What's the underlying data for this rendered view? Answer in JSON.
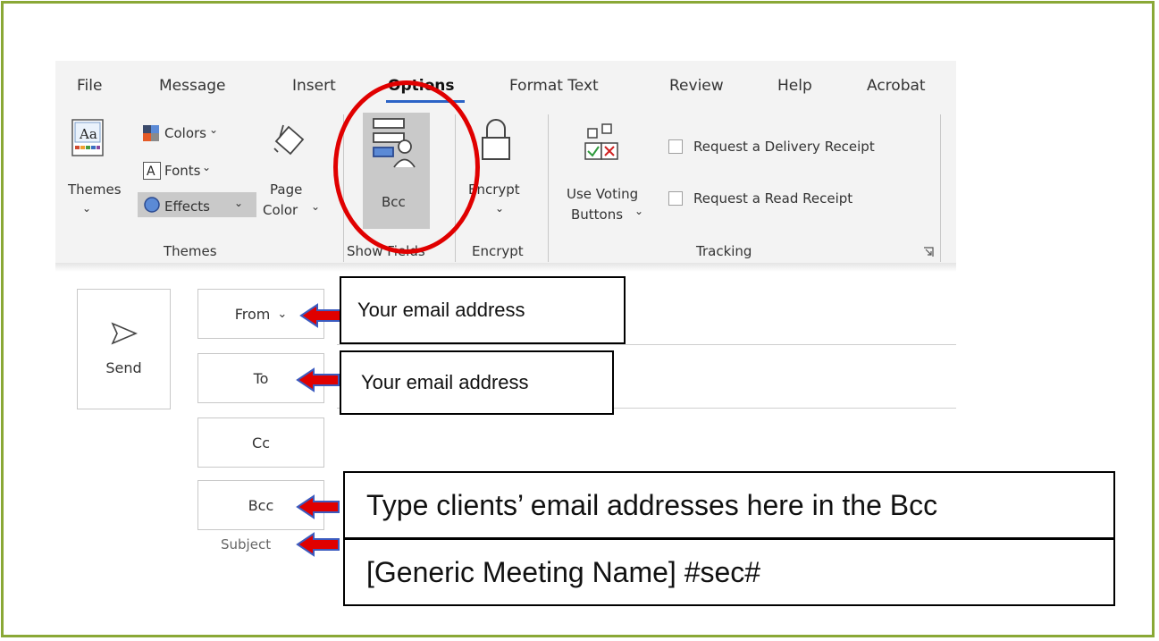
{
  "tabs": [
    "File",
    "Message",
    "Insert",
    "Options",
    "Format Text",
    "Review",
    "Help",
    "Acrobat"
  ],
  "active_tab": "Options",
  "ribbon": {
    "themes_button": "Themes",
    "colors": "Colors",
    "fonts": "Fonts",
    "effects": "Effects",
    "page_color_line1": "Page",
    "page_color_line2": "Color",
    "bcc": "Bcc",
    "encrypt": "Encrypt",
    "voting_line1": "Use Voting",
    "voting_line2": "Buttons",
    "delivery_receipt": "Request a Delivery Receipt",
    "read_receipt": "Request a Read Receipt",
    "groups": {
      "themes": "Themes",
      "show_fields": "Show Fields",
      "encrypt": "Encrypt",
      "tracking": "Tracking"
    }
  },
  "compose": {
    "send": "Send",
    "from": "From",
    "to": "To",
    "cc": "Cc",
    "bcc": "Bcc",
    "subject": "Subject"
  },
  "callouts": {
    "from": "Your email address",
    "to": "Your email address",
    "bcc": "Type clients’ email addresses here in the Bcc",
    "subject": "[Generic Meeting Name] #sec#"
  },
  "colors": {
    "frame": "#8aa836",
    "highlight": "#e00000",
    "tab_underline": "#2b63c6",
    "arrow_fill": "#e00000",
    "arrow_edge": "#3b5bbf"
  }
}
